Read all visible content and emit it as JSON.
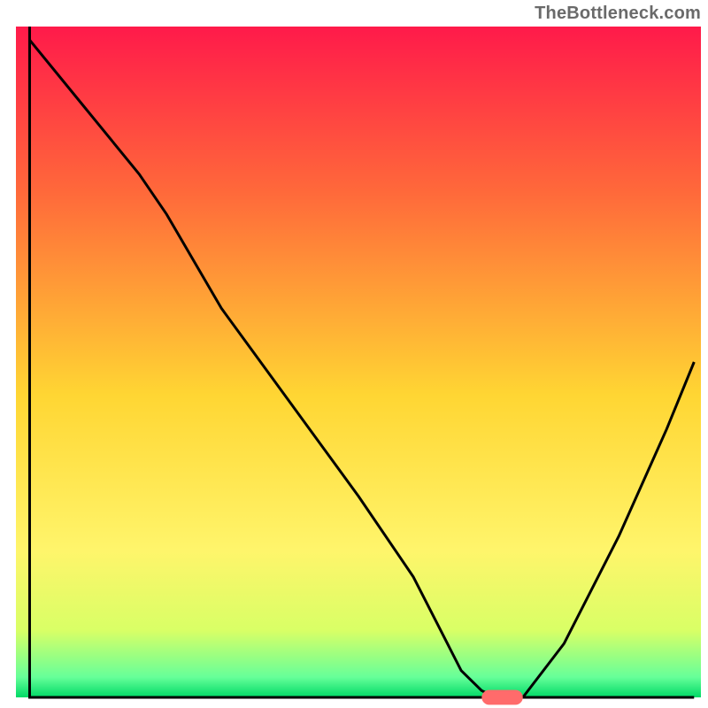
{
  "watermark": "TheBottleneck.com",
  "chart_data": {
    "type": "line",
    "title": "",
    "xlabel": "",
    "ylabel": "",
    "xlim": [
      0,
      100
    ],
    "ylim": [
      0,
      100
    ],
    "background_gradient": {
      "stops": [
        {
          "offset": 0.0,
          "color": "#ff1a4a"
        },
        {
          "offset": 0.25,
          "color": "#ff6a3a"
        },
        {
          "offset": 0.55,
          "color": "#ffd633"
        },
        {
          "offset": 0.78,
          "color": "#fff56b"
        },
        {
          "offset": 0.9,
          "color": "#d9ff66"
        },
        {
          "offset": 0.97,
          "color": "#66ff99"
        },
        {
          "offset": 1.0,
          "color": "#00d966"
        }
      ]
    },
    "series": [
      {
        "name": "bottleneck-curve",
        "color": "#000000",
        "x": [
          2,
          10,
          18,
          22,
          30,
          40,
          50,
          58,
          62,
          65,
          68,
          70,
          74,
          80,
          88,
          95,
          99
        ],
        "values": [
          98,
          88,
          78,
          72,
          58,
          44,
          30,
          18,
          10,
          4,
          1,
          0,
          0,
          8,
          24,
          40,
          50
        ]
      }
    ],
    "marker": {
      "name": "optimal-point",
      "x_center": 71,
      "y": 0,
      "width": 6,
      "height": 2.2,
      "color": "#ff6b6b"
    },
    "axes": {
      "left": {
        "x": 2,
        "y0": 0,
        "y1": 100
      },
      "bottom": {
        "y": 0,
        "x0": 2,
        "x1": 99
      }
    }
  }
}
